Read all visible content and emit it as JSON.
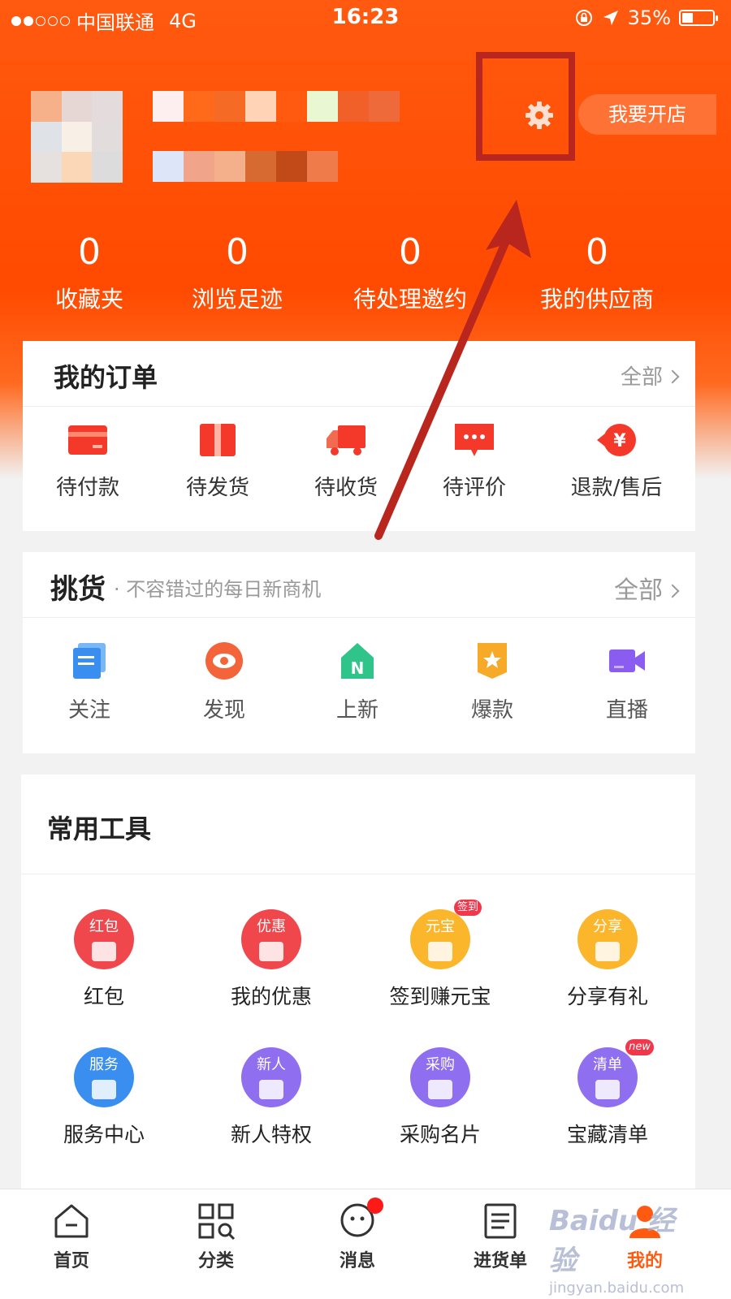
{
  "status_bar": {
    "carrier": "中国联通",
    "network": "4G",
    "time": "16:23",
    "battery": "35%",
    "battery_level": 0.35
  },
  "profile": {
    "open_store_label": "我要开店",
    "settings_icon": "gear-icon"
  },
  "stats": [
    {
      "count": "0",
      "label": "收藏夹"
    },
    {
      "count": "0",
      "label": "浏览足迹"
    },
    {
      "count": "0",
      "label": "待处理邀约"
    },
    {
      "count": "0",
      "label": "我的供应商"
    }
  ],
  "orders": {
    "title": "我的订单",
    "all_label": "全部",
    "items": [
      {
        "label": "待付款",
        "icon": "card-icon"
      },
      {
        "label": "待发货",
        "icon": "package-icon"
      },
      {
        "label": "待收货",
        "icon": "truck-icon"
      },
      {
        "label": "待评价",
        "icon": "comment-icon"
      },
      {
        "label": "退款/售后",
        "icon": "refund-icon"
      }
    ]
  },
  "pick": {
    "title": "挑货",
    "subtitle": "· 不容错过的每日新商机",
    "all_label": "全部",
    "items": [
      {
        "label": "关注",
        "icon": "follow-icon"
      },
      {
        "label": "发现",
        "icon": "eye-icon"
      },
      {
        "label": "上新",
        "icon": "new-house-icon"
      },
      {
        "label": "爆款",
        "icon": "star-badge-icon"
      },
      {
        "label": "直播",
        "icon": "video-camera-icon"
      }
    ]
  },
  "tools": {
    "title": "常用工具",
    "items": [
      {
        "label": "红包",
        "icon_text": "红包",
        "color": "#f0474c"
      },
      {
        "label": "我的优惠",
        "icon_text": "优惠",
        "color": "#f0474c"
      },
      {
        "label": "签到赚元宝",
        "icon_text": "元宝",
        "color": "#fbb62b",
        "badge": "签到"
      },
      {
        "label": "分享有礼",
        "icon_text": "分享",
        "color": "#fbb62b"
      },
      {
        "label": "服务中心",
        "icon_text": "服务",
        "color": "#3a8ef0"
      },
      {
        "label": "新人特权",
        "icon_text": "新人",
        "color": "#8f6ef0"
      },
      {
        "label": "采购名片",
        "icon_text": "采购",
        "color": "#8f6ef0"
      },
      {
        "label": "宝藏清单",
        "icon_text": "清单",
        "color": "#8f6ef0",
        "badge": "new"
      }
    ]
  },
  "tabbar": [
    {
      "label": "首页",
      "icon": "home-icon"
    },
    {
      "label": "分类",
      "icon": "category-icon"
    },
    {
      "label": "消息",
      "icon": "message-icon"
    },
    {
      "label": "进货单",
      "icon": "order-list-icon"
    },
    {
      "label": "我的",
      "icon": "profile-icon"
    }
  ],
  "watermark": {
    "brand": "Baidu 经验",
    "url": "jingyan.baidu.com"
  },
  "colors": {
    "brand_orange": "#ff4a00",
    "highlight_red": "#b8261e"
  }
}
